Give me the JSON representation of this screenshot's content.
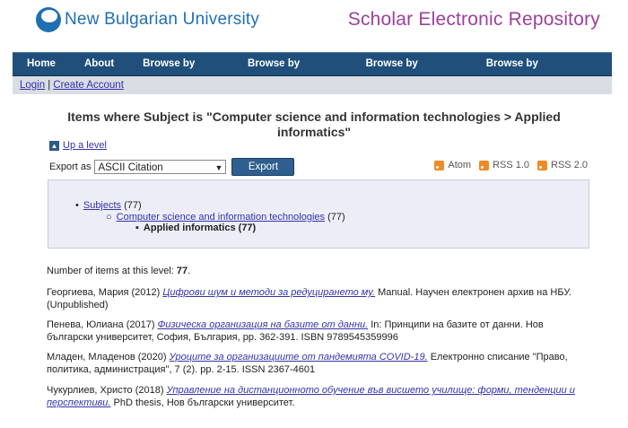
{
  "header": {
    "university_name": "New Bulgarian University",
    "repository_name": "Scholar Electronic Repository"
  },
  "nav": {
    "items": [
      "Home",
      "About",
      "Browse by Year",
      "Browse by Person",
      "Browse by Subject",
      "Browse by Department"
    ]
  },
  "subnav": {
    "login": "Login",
    "separator": "|",
    "create_account": "Create Account"
  },
  "page": {
    "title": "Items where Subject is \"Computer science and information technologies > Applied informatics\"",
    "up_level": "Up a level",
    "export_label": "Export as",
    "export_format": "ASCII Citation",
    "export_button": "Export",
    "feeds": [
      "Atom",
      "RSS 1.0",
      "RSS 2.0"
    ]
  },
  "subjects": {
    "level1_label": "Subjects",
    "level1_count": "(77)",
    "level2_label": "Computer science and information technologies",
    "level2_count": "(77)",
    "level3_label": "Applied informatics",
    "level3_count": "(77)"
  },
  "items_count": {
    "label": "Number of items at this level:",
    "value": "77"
  },
  "entries": [
    {
      "author_year": "Георгиева, Мария (2012)",
      "title": "Цифрови шум и методи за редуцирането му.",
      "rest": "Manual. Научен електронен архив на НБУ. (Unpublished)"
    },
    {
      "author_year": "Пенева, Юлиана (2017)",
      "title": "Физическа организация на базите от данни.",
      "rest": "In: Принципи на базите от данни. Нов български университет, София, България, pp. 362-391. ISBN 9789545359996"
    },
    {
      "author_year": "Младен, Младенов (2020)",
      "title": "Уроците за организациите от пандемията COVID-19.",
      "rest": "Електронно списание \"Право, политика, администрация\", 7 (2). pp. 2-15. ISSN 2367-4601"
    },
    {
      "author_year": "Чукурлиев, Христо (2018)",
      "title": "Управление на дистанционното обучение във висшето училище: форми, тенденции и перспективи.",
      "rest": "PhD thesis, Нов български университет."
    }
  ]
}
